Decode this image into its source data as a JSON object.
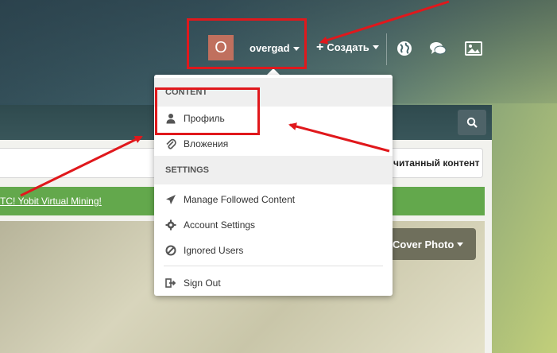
{
  "user_nav": {
    "avatar_letter": "O",
    "username": "overgad",
    "create_label": "Создать"
  },
  "icons": [
    "globe-icon",
    "chat-icon",
    "image-icon",
    "search-icon",
    "user-icon",
    "paperclip-icon",
    "paper-plane-icon",
    "gear-icon",
    "ban-icon",
    "sign-out-icon"
  ],
  "page": {
    "unread_tab": "читанный контент",
    "banner_text": "TC! Yobit Virtual Mining!",
    "cover_button": "Cover Photo"
  },
  "dropdown": {
    "content_heading": "CONTENT",
    "settings_heading": "SETTINGS",
    "items": [
      {
        "label": "Профиль",
        "icon": "user-icon"
      },
      {
        "label": "Вложения",
        "icon": "paperclip-icon"
      },
      {
        "label": "Manage Followed Content",
        "icon": "paper-plane-icon"
      },
      {
        "label": "Account Settings",
        "icon": "gear-icon"
      },
      {
        "label": "Ignored Users",
        "icon": "ban-icon"
      },
      {
        "label": "Sign Out",
        "icon": "sign-out-icon"
      }
    ]
  },
  "colors": {
    "annotation": "#e0181c",
    "avatar": "#c0705e",
    "banner": "#63a84c"
  }
}
